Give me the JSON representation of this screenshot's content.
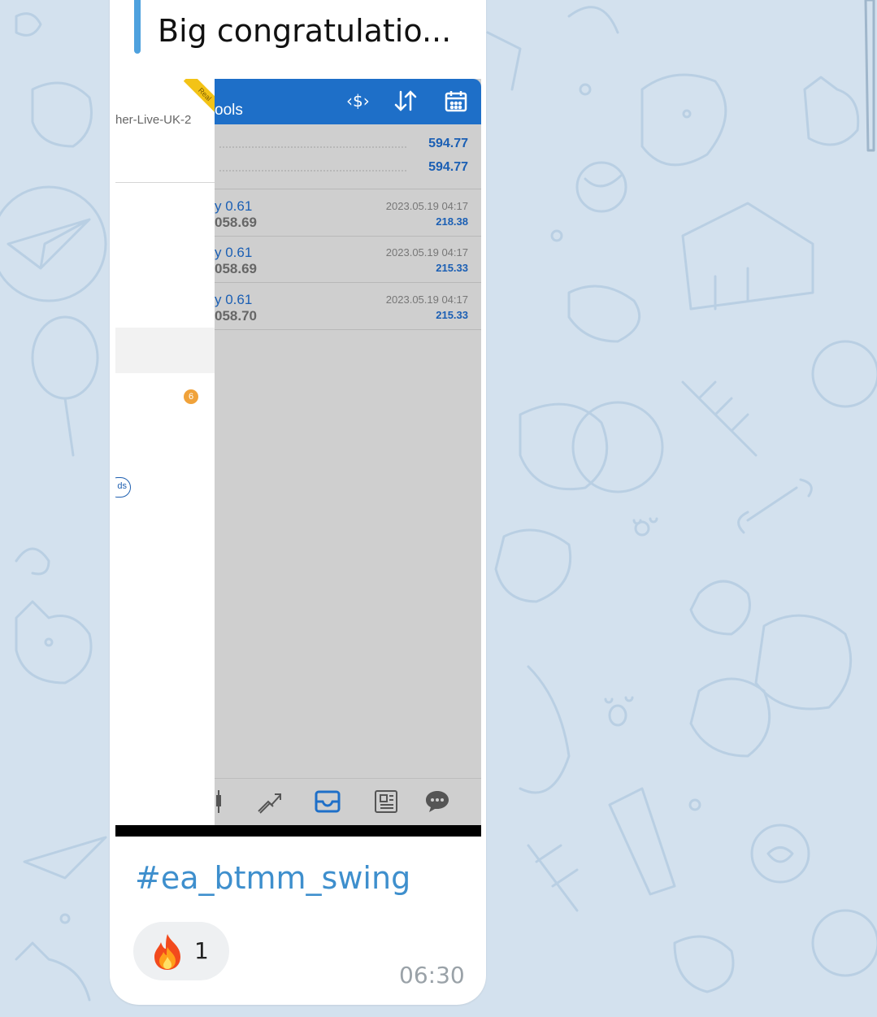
{
  "message": {
    "reply_preview": "Big congratulatio...",
    "hashtag": "#ea_btmm_swing",
    "reaction": {
      "emoji": "fire-icon",
      "count": "1"
    },
    "time": "06:30"
  },
  "screenshot": {
    "left_panel": {
      "server": "her-Live-UK-2",
      "badge_count": "6",
      "pill_text": "ds",
      "ribbon_text": "Real"
    },
    "toolbar": {
      "title": "ools"
    },
    "summary": [
      "594.77",
      "594.77"
    ],
    "trades": [
      {
        "lot": "y 0.61",
        "price": "058.69",
        "date": "2023.05.19 04:17",
        "profit": "218.38"
      },
      {
        "lot": "y 0.61",
        "price": "058.69",
        "date": "2023.05.19 04:17",
        "profit": "215.33"
      },
      {
        "lot": "y 0.61",
        "price": "058.70",
        "date": "2023.05.19 04:17",
        "profit": "215.33"
      }
    ]
  },
  "colors": {
    "chat_background": "#d3e1ee",
    "accent": "#4ea1de",
    "toolbar_blue": "#1e6fc8",
    "link": "#3e8fcd"
  }
}
